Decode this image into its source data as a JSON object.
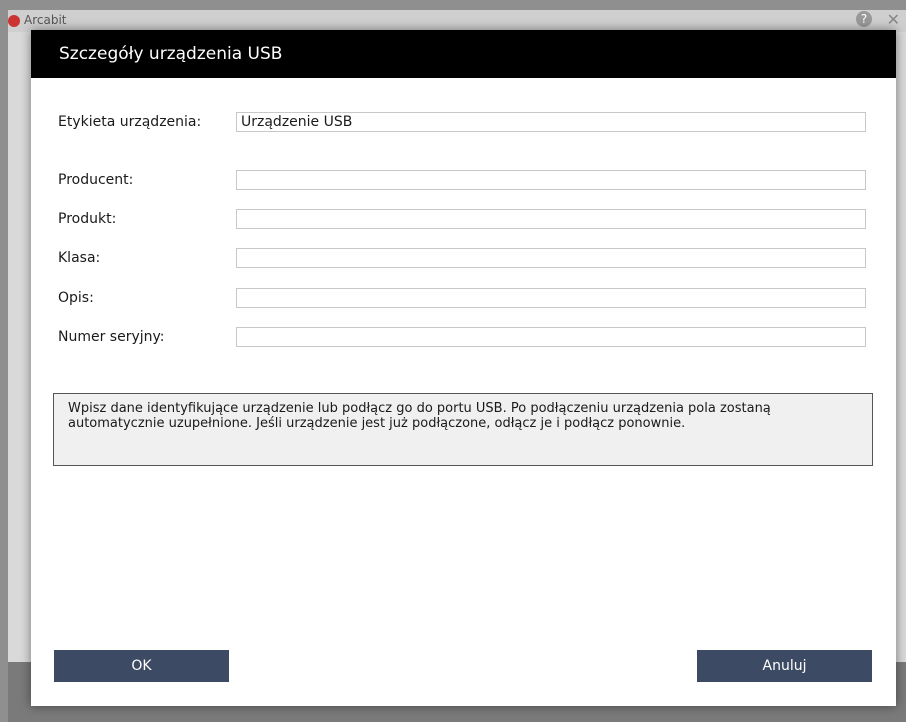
{
  "background_window": {
    "title": "Arcabit"
  },
  "dialog": {
    "title": "Szczegóły urządzenia USB",
    "fields": [
      {
        "label": "Etykieta urządzenia:",
        "value": ""
      },
      {
        "label": "Producent:",
        "value": ""
      },
      {
        "label": "Produkt:",
        "value": ""
      },
      {
        "label": "Klasa:",
        "value": ""
      },
      {
        "label": "Opis:",
        "value": ""
      },
      {
        "label": "Numer seryjny:",
        "value": ""
      }
    ],
    "label_value": "Urządzenie USB",
    "info_text": "Wpisz dane identyfikujące urządzenie lub podłącz go do portu USB. Po podłączeniu urządzenia pola zostaną automatycznie uzupełnione. Jeśli urządzenie jest już podłączone, odłącz je i podłącz ponownie.",
    "ok_label": "OK",
    "cancel_label": "Anuluj"
  },
  "colors": {
    "header_bg": "#000000",
    "button_bg": "#3d4a63",
    "info_bg": "#f0f0f0"
  }
}
